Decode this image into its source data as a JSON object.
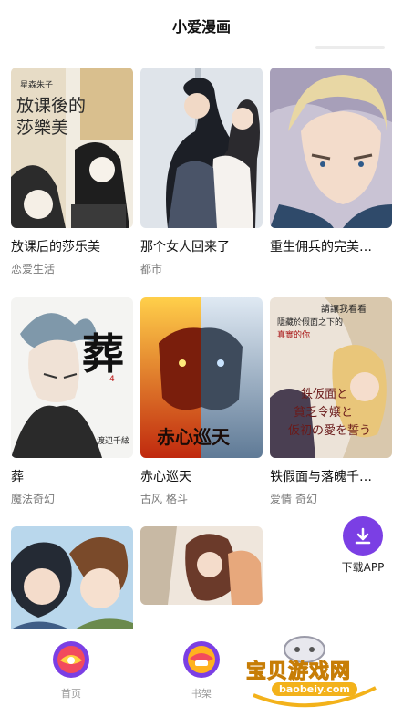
{
  "app": {
    "title": "小爱漫画"
  },
  "comics": [
    {
      "title": "放课后的莎乐美",
      "tags": [
        "恋爱生活"
      ],
      "cover_text": [
        "放课後的",
        "莎樂美",
        "星森朱子"
      ]
    },
    {
      "title": "那个女人回来了",
      "tags": [
        "都市"
      ],
      "cover_text": []
    },
    {
      "title": "重生佣兵的完美…",
      "tags": [],
      "cover_text": []
    },
    {
      "title": "葬",
      "tags": [
        "魔法奇幻"
      ],
      "cover_text": [
        "葬",
        "4",
        "渡辺千絃"
      ]
    },
    {
      "title": "赤心巡天",
      "tags": [
        "古风",
        "格斗"
      ],
      "cover_text": [
        "赤心巡天"
      ]
    },
    {
      "title": "铁假面与落魄千…",
      "tags": [
        "爱情",
        "奇幻"
      ],
      "cover_text": [
        "請讓我看看",
        "隱藏於假面之下的",
        "真實的你",
        "鉄仮面と",
        "貧乏令嬢と",
        "仮初の愛を誓う"
      ]
    },
    {
      "title": "",
      "tags": [],
      "cover_text": []
    },
    {
      "title": "",
      "tags": [],
      "cover_text": []
    }
  ],
  "download": {
    "label": "下载APP",
    "icon": "download-icon",
    "color": "#7b3fe4"
  },
  "tabbar": {
    "tabs": [
      {
        "label": "首页",
        "icon": "home-tab-icon"
      },
      {
        "label": "书架",
        "icon": "bookshelf-tab-icon"
      }
    ]
  },
  "watermark": {
    "text": "宝贝游戏网",
    "url": "baobeiy.com"
  }
}
